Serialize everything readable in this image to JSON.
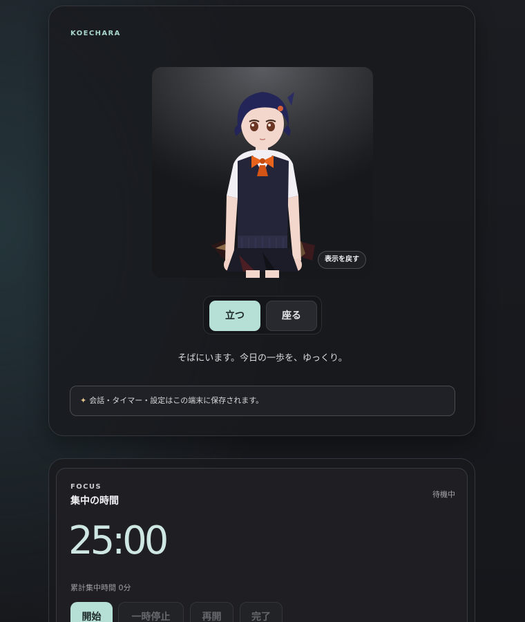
{
  "brand": "KOECHARA",
  "avatar": {
    "restore_label": "表示を戻す"
  },
  "pose": {
    "stand_label": "立つ",
    "sit_label": "座る",
    "selected": "stand"
  },
  "message": "そばにいます。今日の一歩を、ゆっくり。",
  "notice": {
    "icon": "sparkle-icon",
    "text": "会話・タイマー・設定はこの端末に保存されます。"
  },
  "focus": {
    "label": "FOCUS",
    "title": "集中の時間",
    "status": "待機中",
    "timer": "25:00",
    "total": "累計集中時間 0分",
    "buttons": {
      "start": "開始",
      "pause": "一時停止",
      "resume": "再開",
      "done": "完了"
    }
  },
  "colors": {
    "accent": "#b6dfd5",
    "timer": "#cfe7e1",
    "brand": "#a9d6cb"
  }
}
